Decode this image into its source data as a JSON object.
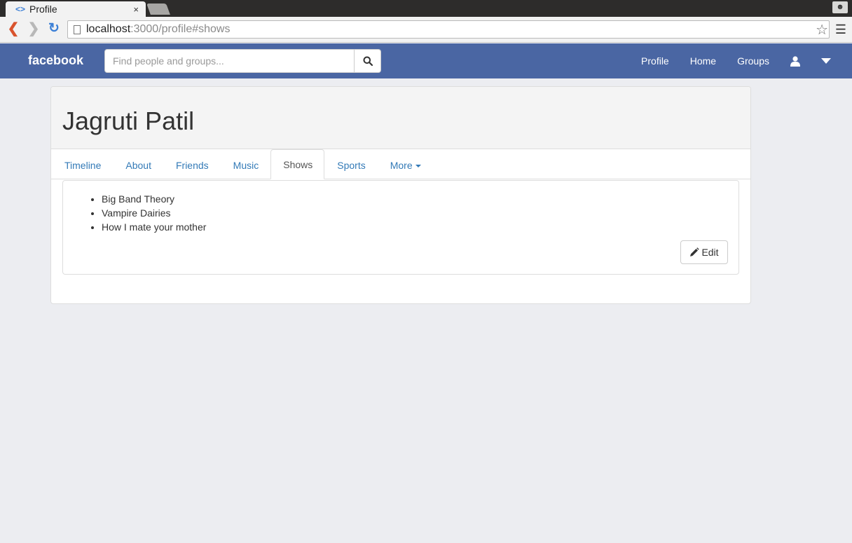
{
  "browser": {
    "tab_title": "Profile",
    "tab_close": "×",
    "url_host": "localhost",
    "url_rest": ":3000/profile#shows"
  },
  "navbar": {
    "brand": "facebook",
    "search_placeholder": "Find people and groups...",
    "links": [
      "Profile",
      "Home",
      "Groups"
    ]
  },
  "profile": {
    "name": "Jagruti Patil",
    "tabs": [
      "Timeline",
      "About",
      "Friends",
      "Music",
      "Shows",
      "Sports",
      "More"
    ],
    "active_tab": "Shows",
    "shows": [
      "Big Band Theory",
      "Vampire Dairies",
      "How I mate your mother"
    ],
    "edit_label": "Edit"
  },
  "colors": {
    "navbar": "#4a66a3",
    "link": "#337ab7",
    "page_bg": "#ecedf1"
  }
}
